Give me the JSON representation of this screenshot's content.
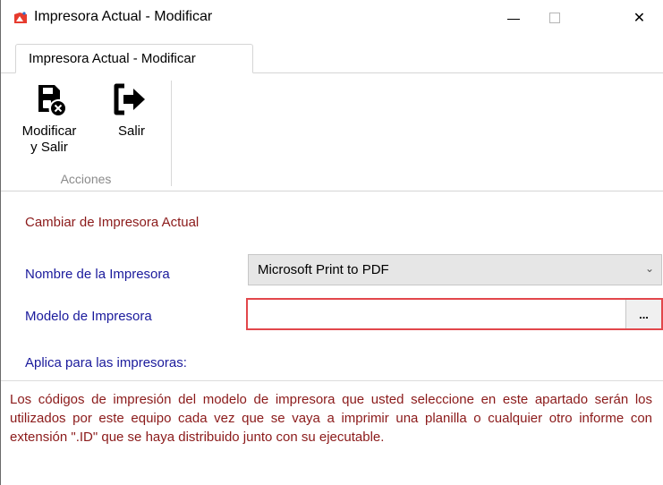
{
  "window": {
    "title": "Impresora Actual - Modificar",
    "controls": {
      "minimize": "minimize-icon",
      "maximize": "maximize-icon",
      "close": "✕"
    }
  },
  "ribbon": {
    "tab_label": "Impresora Actual - Modificar",
    "buttons": [
      {
        "label_line1": "Modificar",
        "label_line2": "y Salir",
        "icon": "save-close-icon"
      },
      {
        "label": "Salir",
        "icon": "exit-icon"
      }
    ],
    "group_label": "Acciones"
  },
  "form": {
    "section_title": "Cambiar de Impresora Actual",
    "printer_label": "Nombre de la Impresora",
    "printer_value": "Microsoft Print to PDF",
    "model_label": "Modelo de Impresora",
    "model_value": "",
    "model_button": "...",
    "applies_label": "Aplica para las impresoras:"
  },
  "info": {
    "text": "Los códigos de impresión del modelo de impresora que usted seleccione en este apartado serán los utilizados por este equipo cada vez que se vaya a imprimir una planilla  o cualquier otro informe con extensión \".ID\" que se haya distribuido junto con su ejecutable."
  },
  "colors": {
    "section_title": "#8b1a1a",
    "label": "#1a1a9c",
    "error_border": "#e2474b"
  }
}
